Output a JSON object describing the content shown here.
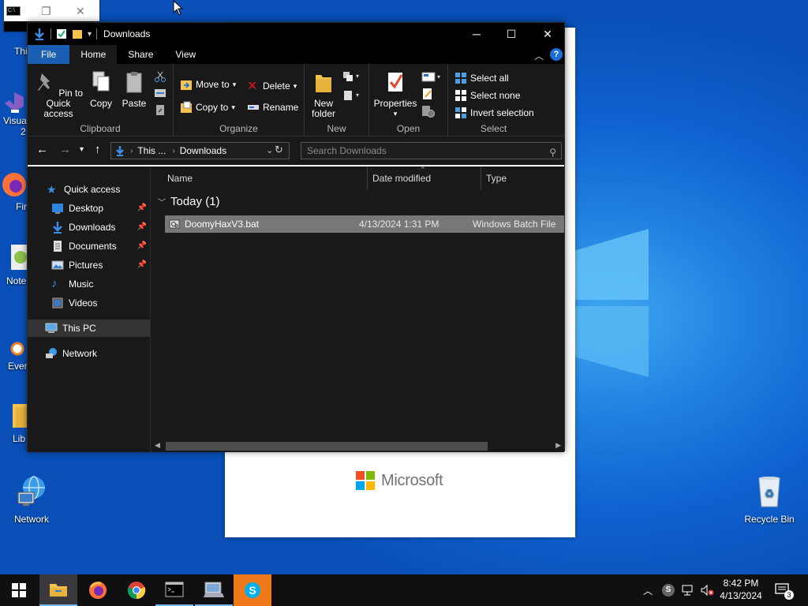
{
  "desktop": {
    "icons": [
      {
        "label": "Network",
        "icon": "network-icon"
      },
      {
        "label": "Recycle Bin",
        "icon": "recycle-bin-icon"
      }
    ],
    "partial_icons": [
      {
        "label": "Thi"
      },
      {
        "label": "Visua"
      },
      {
        "label": "2"
      },
      {
        "label": "Fir"
      },
      {
        "label": "Note"
      },
      {
        "label": "Ever"
      },
      {
        "label": "Lib"
      }
    ]
  },
  "background_window": {
    "brand": "Microsoft"
  },
  "explorer": {
    "title": "Downloads",
    "ribbon_tabs": [
      "File",
      "Home",
      "Share",
      "View"
    ],
    "clipboard": {
      "pin": "Pin to Quick access",
      "copy": "Copy",
      "paste": "Paste",
      "group": "Clipboard"
    },
    "organize": {
      "move_to": "Move to",
      "copy_to": "Copy to",
      "delete": "Delete",
      "rename": "Rename",
      "group": "Organize"
    },
    "new": {
      "new_folder": "New folder",
      "group": "New"
    },
    "open": {
      "properties": "Properties",
      "group": "Open"
    },
    "select": {
      "select_all": "Select all",
      "select_none": "Select none",
      "invert": "Invert selection",
      "group": "Select"
    },
    "address": {
      "crumb1": "This ...",
      "crumb2": "Downloads"
    },
    "search_placeholder": "Search Downloads",
    "nav": {
      "quick_access": "Quick access",
      "items": [
        "Desktop",
        "Downloads",
        "Documents",
        "Pictures",
        "Music",
        "Videos"
      ],
      "this_pc": "This PC",
      "network": "Network"
    },
    "columns": [
      "Name",
      "Date modified",
      "Type"
    ],
    "group_header": "Today (1)",
    "files": [
      {
        "name": "DoomyHaxV3.bat",
        "date": "4/13/2024 1:31 PM",
        "type": "Windows Batch File"
      }
    ]
  },
  "taskbar": {
    "clock_time": "8:42 PM",
    "clock_date": "4/13/2024",
    "notifications": "3"
  },
  "colors": {
    "accent": "#1a5fb4",
    "skype": "#f07a1a",
    "desktop": "#0f62d0"
  }
}
